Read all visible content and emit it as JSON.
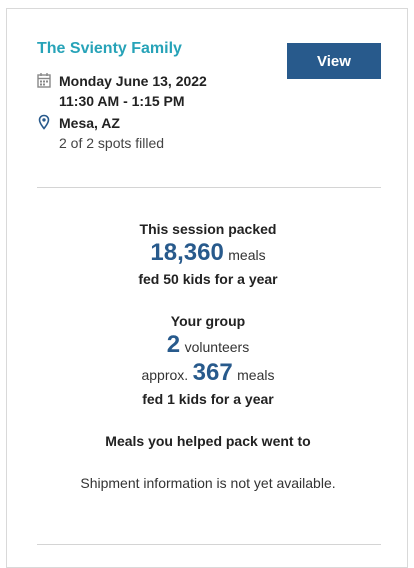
{
  "event": {
    "title": "The Svienty Family",
    "date": "Monday June 13, 2022",
    "time": "11:30 AM - 1:15 PM",
    "location": "Mesa, AZ",
    "spots": "2 of 2 spots filled",
    "view_label": "View"
  },
  "session": {
    "heading": "This session packed",
    "meals_count": "18,360",
    "meals_unit": "meals",
    "fed_text": "fed 50 kids for a year"
  },
  "group": {
    "heading": "Your group",
    "volunteers_count": "2",
    "volunteers_unit": "volunteers",
    "approx_prefix": "approx.",
    "meals_count": "367",
    "meals_unit": "meals",
    "fed_text": "fed 1 kids for a year"
  },
  "shipment": {
    "heading": "Meals you helped pack went to",
    "status": "Shipment information is not yet available."
  },
  "colors": {
    "title": "#27a3b8",
    "accent": "#285a8c"
  },
  "icons": {
    "date": "calendar-icon",
    "location": "map-pin-icon"
  }
}
